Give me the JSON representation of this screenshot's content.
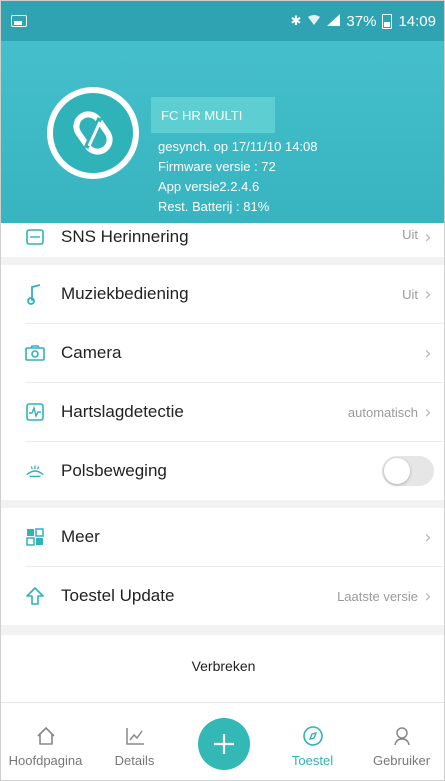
{
  "status_bar": {
    "battery_percent": "37%",
    "time": "14:09",
    "icons": [
      "bluetooth-icon",
      "wifi-icon",
      "signal-icon",
      "battery-icon"
    ]
  },
  "header": {
    "device_name": "FC HR MULTI",
    "sync_text": "gesynch. op 17/11/10 14:08",
    "firmware_text": "Firmware versie : 72",
    "app_version_text": "App versie2.2.4.6",
    "battery_text": "Rest. Batterij : 81%"
  },
  "settings": {
    "sns": {
      "label": "SNS Herinnering",
      "value": "Uit"
    },
    "music": {
      "label": "Muziekbediening",
      "value": "Uit"
    },
    "camera": {
      "label": "Camera",
      "value": ""
    },
    "heart_rate": {
      "label": "Hartslagdetectie",
      "value": "automatisch"
    },
    "wrist": {
      "label": "Polsbeweging",
      "toggle_on": false
    },
    "more": {
      "label": "Meer",
      "value": ""
    },
    "update": {
      "label": "Toestel Update",
      "value": "Laatste versie"
    }
  },
  "disconnect_label": "Verbreken",
  "bottom_nav": {
    "home": "Hoofdpagina",
    "details": "Details",
    "device": "Toestel",
    "user": "Gebruiker",
    "active": "device"
  },
  "colors": {
    "accent": "#33b8b6",
    "header_bg": "#3cb8c4",
    "device_name_box": "#5dcfd3"
  }
}
